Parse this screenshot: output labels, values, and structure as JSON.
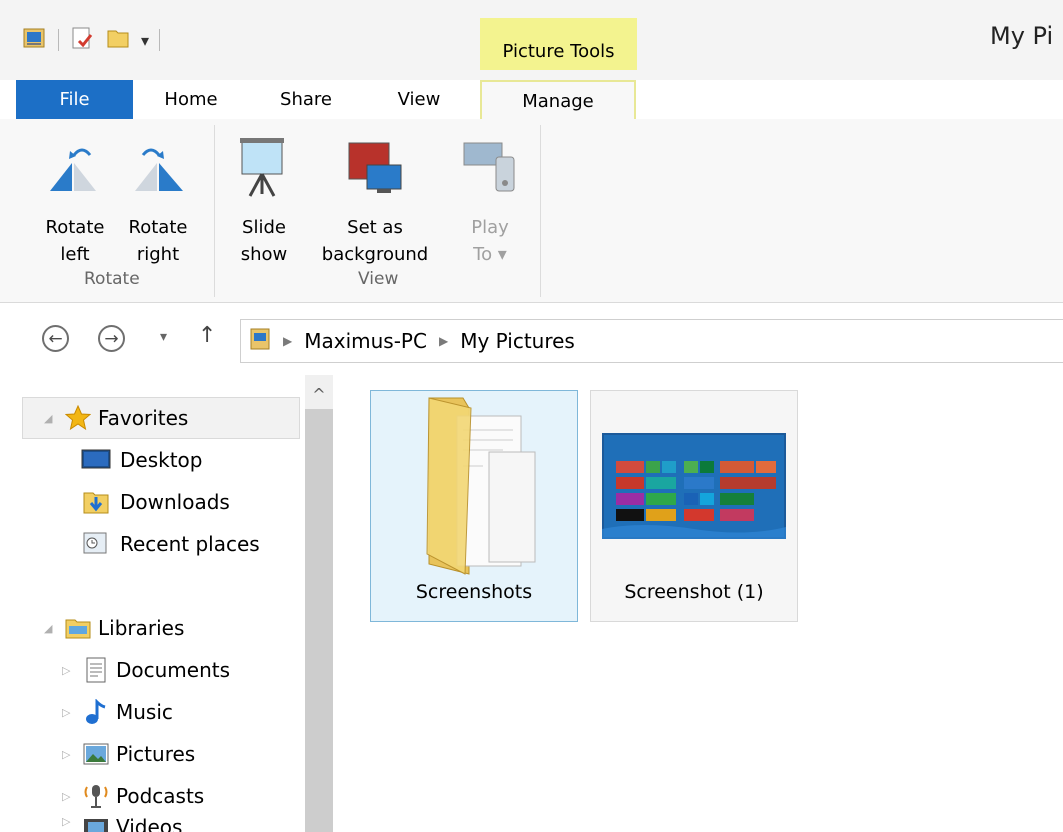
{
  "window": {
    "title": "My Pi",
    "context_tab": "Picture Tools"
  },
  "tabs": {
    "file": "File",
    "home": "Home",
    "share": "Share",
    "view": "View",
    "manage": "Manage"
  },
  "ribbon": {
    "rotate_left": [
      "Rotate",
      "left"
    ],
    "rotate_right": [
      "Rotate",
      "right"
    ],
    "rotate_group": "Rotate",
    "slideshow": [
      "Slide",
      "show"
    ],
    "set_background": [
      "Set as",
      "background"
    ],
    "play_to": [
      "Play",
      "To ▾"
    ],
    "view_group": "View"
  },
  "address": {
    "crumbs": [
      "Maximus-PC",
      "My Pictures"
    ]
  },
  "navpane": {
    "favorites": "Favorites",
    "desktop": "Desktop",
    "downloads": "Downloads",
    "recent": "Recent places",
    "libraries": "Libraries",
    "documents": "Documents",
    "music": "Music",
    "pictures": "Pictures",
    "podcasts": "Podcasts",
    "videos": "Videos"
  },
  "items": [
    {
      "name": "Screenshots",
      "type": "folder",
      "selected": true
    },
    {
      "name": "Screenshot (1)",
      "type": "image",
      "selected": false
    }
  ],
  "colors": {
    "file_tab": "#1c6fc6",
    "context_tab": "#f3f38f",
    "selection": "#e5f3fb"
  }
}
